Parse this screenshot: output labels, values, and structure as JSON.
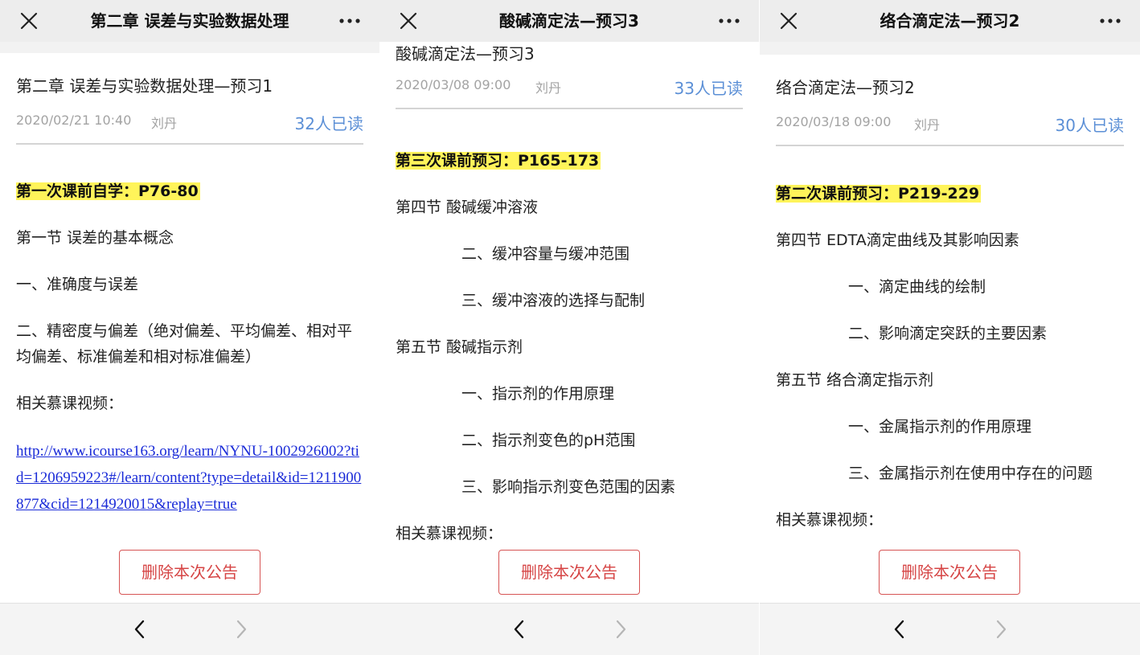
{
  "screens": [
    {
      "topbar_title": "第二章 误差与实验数据处理",
      "title": "第二章 误差与实验数据处理—预习1",
      "date": "2020/02/21 10:40",
      "author": "刘丹",
      "reads": "32人已读",
      "highlight": "第一次课前自学：P76-80",
      "lines": [
        "第一节 误差的基本概念",
        "一、准确度与误差",
        "二、精密度与偏差（绝对偏差、平均偏差、相对平均偏差、标准偏差和相对标准偏差）",
        "相关慕课视频："
      ],
      "link": "http://www.icourse163.org/learn/NYNU-1002926002?tid=1206959223#/learn/content?type=detail&id=1211900877&cid=1214920015&replay=true",
      "delete_label": "删除本次公告"
    },
    {
      "topbar_title": "酸碱滴定法—预习3",
      "title": "酸碱滴定法—预习3",
      "date": "2020/03/08 09:00",
      "author": "刘丹",
      "reads": "33人已读",
      "highlight": "第三次课前预习：P165-173",
      "lines": [
        "第四节 酸碱缓冲溶液",
        "二、缓冲容量与缓冲范围",
        "三、缓冲溶液的选择与配制",
        "第五节 酸碱指示剂",
        "一、指示剂的作用原理",
        "二、指示剂变色的pH范围",
        "三、影响指示剂变色范围的因素",
        "相关慕课视频："
      ],
      "delete_label": "删除本次公告"
    },
    {
      "topbar_title": "络合滴定法—预习2",
      "title": "络合滴定法—预习2",
      "date": "2020/03/18 09:00",
      "author": "刘丹",
      "reads": "30人已读",
      "highlight": "第二次课前预习：P219-229",
      "lines": [
        "第四节 EDTA滴定曲线及其影响因素",
        "一、滴定曲线的绘制",
        "二、影响滴定突跃的主要因素",
        "第五节 络合滴定指示剂",
        "一、金属指示剂的作用原理",
        "三、金属指示剂在使用中存在的问题",
        "相关慕课视频："
      ],
      "delete_label": "删除本次公告"
    }
  ],
  "icons": {
    "close": "close-icon",
    "more": "more-icon",
    "back": "chevron-left-icon",
    "forward": "chevron-right-icon"
  },
  "colors": {
    "highlight": "#fff45a",
    "reads": "#5b8fd6",
    "delete": "#d64545",
    "link": "#1a2bd8"
  }
}
